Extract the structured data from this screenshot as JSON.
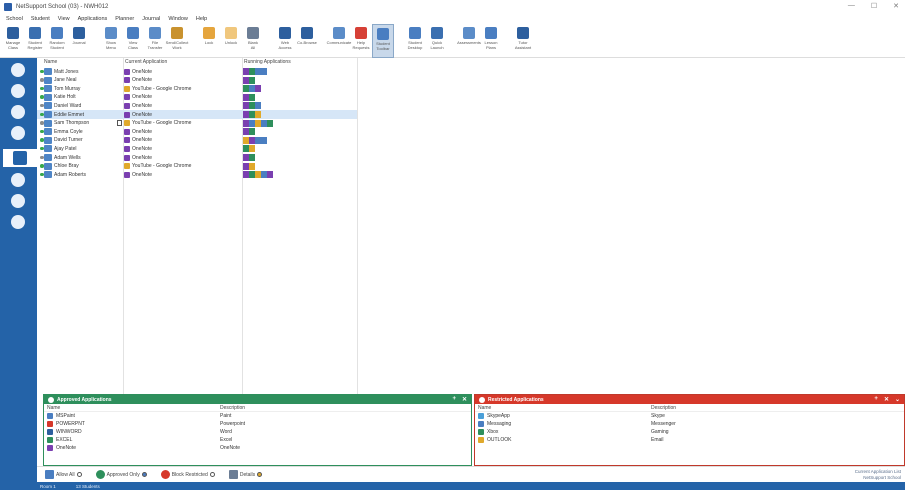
{
  "window": {
    "title": "NetSupport School (03) - NWH012",
    "controls": [
      "—",
      "☐",
      "✕"
    ]
  },
  "menu": [
    "School",
    "Student",
    "View",
    "Applications",
    "Planner",
    "Journal",
    "Window",
    "Help"
  ],
  "toolbar": [
    {
      "label": "Manage\nClass",
      "icon": "manage-class-icon",
      "color": "#2d5f9e"
    },
    {
      "label": "Student\nRegister",
      "icon": "student-register-icon",
      "color": "#3a6fb0"
    },
    {
      "label": "Random\nStudent",
      "icon": "random-student-icon",
      "color": "#4a7ec1"
    },
    {
      "label": "Journal",
      "icon": "journal-icon",
      "color": "#2d5f9e"
    },
    {
      "label": "Show\nMenu",
      "icon": "show-menu-icon",
      "color": "#5b8cc8",
      "space": true
    },
    {
      "label": "View\nClass",
      "icon": "view-class-icon",
      "color": "#4a7ec1"
    },
    {
      "label": "File\nTransfer",
      "icon": "file-transfer-icon",
      "color": "#5b8cc8"
    },
    {
      "label": "Send/Collect\nWork",
      "icon": "send-collect-icon",
      "color": "#c9922e"
    },
    {
      "label": "Lock",
      "icon": "lock-icon",
      "color": "#e5a53d",
      "space": true
    },
    {
      "label": "Unlock",
      "icon": "unlock-icon",
      "color": "#f0c77d"
    },
    {
      "label": "Blank\nAll",
      "icon": "blank-all-icon",
      "color": "#6b7d95"
    },
    {
      "label": "Web\nAccess",
      "icon": "web-access-icon",
      "color": "#2d5f9e",
      "space": true
    },
    {
      "label": "Co-Browse",
      "icon": "co-browse-icon",
      "color": "#2d5f9e"
    },
    {
      "label": "Communicate",
      "icon": "communicate-icon",
      "color": "#5b8cc8",
      "space": true
    },
    {
      "label": "Help\nRequests",
      "icon": "help-requests-icon",
      "color": "#d64036"
    },
    {
      "label": "Student\nToolbar",
      "icon": "student-toolbar-icon",
      "color": "#4a7ec1",
      "active": true
    },
    {
      "label": "Student\nDesktop",
      "icon": "student-desktop-icon",
      "color": "#4a7ec1",
      "space": true
    },
    {
      "label": "Quick\nLaunch",
      "icon": "quick-launch-icon",
      "color": "#3a6fb0"
    },
    {
      "label": "Assessments",
      "icon": "assessments-icon",
      "color": "#5b8cc8",
      "space": true
    },
    {
      "label": "Lesson\nPlans",
      "icon": "lesson-plans-icon",
      "color": "#4a7ec1"
    },
    {
      "label": "Tutor\nAssistant",
      "icon": "tutor-assistant-icon",
      "color": "#2d5f9e",
      "space": true
    }
  ],
  "sidebar": {
    "items": [
      {
        "icon": "home-icon"
      },
      {
        "icon": "monitor-icon"
      },
      {
        "icon": "head-profile-icon"
      },
      {
        "icon": "globe-icon"
      },
      {
        "icon": "applications-icon",
        "selected": true
      },
      {
        "icon": "clock-icon"
      },
      {
        "icon": "printer-icon"
      },
      {
        "icon": "grid-icon"
      }
    ],
    "footer": "Static"
  },
  "grid": {
    "columns": {
      "name": "Name",
      "current": "Current Application",
      "running": "Running Applications"
    },
    "rows": [
      {
        "name": "Matt Jones",
        "app": "OneNote",
        "appColor": "#7a3fb0",
        "running": [
          "#7a3fb0",
          "#2e8f5c",
          "#4a7ec1",
          "#4a7ec1"
        ],
        "status": "online"
      },
      {
        "name": "Jane Neal",
        "app": "OneNote",
        "appColor": "#7a3fb0",
        "running": [
          "#7a3fb0",
          "#2e8f5c"
        ],
        "status": "user"
      },
      {
        "name": "Tom Murray",
        "app": "YouTube - Google Chrome",
        "appColor": "#e0a92b",
        "running": [
          "#2e8f5c",
          "#4a7ec1",
          "#7a3fb0"
        ],
        "status": "online"
      },
      {
        "name": "Katie Holt",
        "app": "OneNote",
        "appColor": "#7a3fb0",
        "running": [
          "#7a3fb0",
          "#2e8f5c"
        ],
        "status": "online"
      },
      {
        "name": "Daniel Ward",
        "app": "OneNote",
        "appColor": "#7a3fb0",
        "running": [
          "#7a3fb0",
          "#2e8f5c",
          "#4a7ec1"
        ],
        "status": "user"
      },
      {
        "name": "Eddie Emmet",
        "app": "OneNote",
        "appColor": "#7a3fb0",
        "running": [
          "#7a3fb0",
          "#2e8f5c",
          "#e0a92b"
        ],
        "status": "online",
        "selected": true
      },
      {
        "name": "Sam Thompson",
        "app": "YouTube - Google Chrome",
        "appColor": "#e0a92b",
        "running": [
          "#7a3fb0",
          "#4a7ec1",
          "#e0a92b",
          "#4a7ec1",
          "#2e8f5c"
        ],
        "status": "user",
        "tabIcon": true
      },
      {
        "name": "Emma Coyle",
        "app": "OneNote",
        "appColor": "#7a3fb0",
        "running": [
          "#7a3fb0",
          "#2e8f5c"
        ],
        "status": "online"
      },
      {
        "name": "David Turner",
        "app": "OneNote",
        "appColor": "#7a3fb0",
        "running": [
          "#e0a92b",
          "#7a3fb0",
          "#4a7ec1",
          "#4a7ec1"
        ],
        "status": "online"
      },
      {
        "name": "Ajay Patel",
        "app": "OneNote",
        "appColor": "#7a3fb0",
        "running": [
          "#2e8f5c",
          "#e0a92b"
        ],
        "status": "online"
      },
      {
        "name": "Adam Wells",
        "app": "OneNote",
        "appColor": "#7a3fb0",
        "running": [
          "#7a3fb0",
          "#2e8f5c"
        ],
        "status": "user"
      },
      {
        "name": "Chloe Bray",
        "app": "YouTube - Google Chrome",
        "appColor": "#e0a92b",
        "running": [
          "#7a3fb0",
          "#e0a92b"
        ],
        "status": "online"
      },
      {
        "name": "Adam Roberts",
        "app": "OneNote",
        "appColor": "#7a3fb0",
        "running": [
          "#7a3fb0",
          "#2e8f5c",
          "#e0a92b",
          "#4a7ec1",
          "#7a3fb0"
        ],
        "status": "online"
      }
    ]
  },
  "approved": {
    "title": "Approved Applications",
    "col_name": "Name",
    "col_desc": "Description",
    "rows": [
      {
        "name": "MSPaint",
        "desc": "Paint",
        "color": "#4a7ec1"
      },
      {
        "name": "POWERPNT",
        "desc": "Powerpoint",
        "color": "#d6382a"
      },
      {
        "name": "WINWORD",
        "desc": "Word",
        "color": "#2d5f9e"
      },
      {
        "name": "EXCEL",
        "desc": "Excel",
        "color": "#2e8f5c"
      },
      {
        "name": "OneNote",
        "desc": "OneNote",
        "color": "#7a3fb0"
      }
    ],
    "actions": [
      "+",
      "✕"
    ]
  },
  "restricted": {
    "title": "Restricted Applications",
    "col_name": "Name",
    "col_desc": "Description",
    "rows": [
      {
        "name": "SkypeApp",
        "desc": "Skype",
        "color": "#4a9fd8"
      },
      {
        "name": "Messaging",
        "desc": "Messenger",
        "color": "#4a7ec1"
      },
      {
        "name": "Xbox",
        "desc": "Gaming",
        "color": "#2e8f5c"
      },
      {
        "name": "OUTLOOK",
        "desc": "Email",
        "color": "#e0a92b"
      }
    ],
    "actions": [
      "+",
      "✕",
      "⌄"
    ]
  },
  "bottombar": {
    "allow_all": "Allow All",
    "approved_only": "Approved Only",
    "block_restricted": "Block Restricted",
    "details": "Details",
    "right_line1": "Current Application List",
    "right_line2": "NetSupport School"
  },
  "statusbar": {
    "room": "Room 1",
    "students": "13 Students"
  }
}
